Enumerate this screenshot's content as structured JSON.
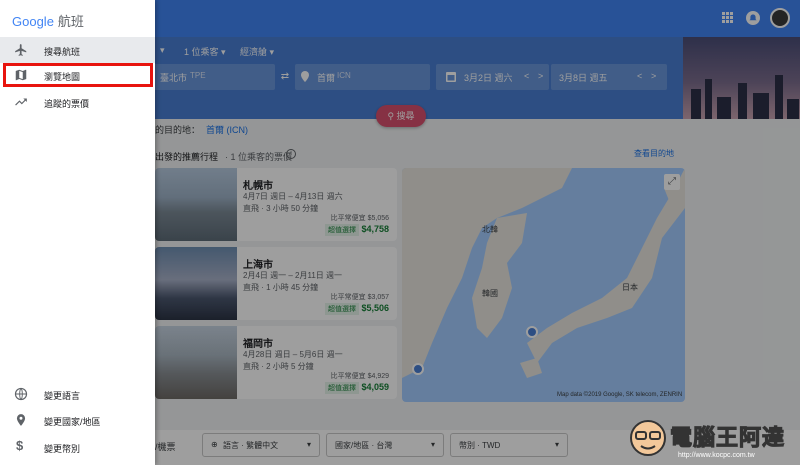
{
  "drawer": {
    "logo_word": "Google",
    "logo_product": "航班",
    "items": [
      {
        "label": "搜尋航班",
        "icon": "airplane-icon"
      },
      {
        "label": "瀏覽地圖",
        "icon": "map-icon"
      },
      {
        "label": "追蹤的票價",
        "icon": "trending-up-icon"
      }
    ],
    "footer": [
      {
        "label": "變更語言",
        "icon": "globe-icon"
      },
      {
        "label": "變更國家/地區",
        "icon": "location-pin-icon"
      },
      {
        "label": "變更幣別",
        "icon": "dollar-icon"
      }
    ]
  },
  "search": {
    "passengers": "1 位乘客 ▾",
    "cabin": "經濟艙 ▾",
    "origin": "臺北市",
    "origin_code": "TPE",
    "destination": "首爾",
    "destination_code": "ICN",
    "depart_date": "3月2日 週六",
    "return_date": "3月8日 週五",
    "button": "搜尋",
    "nav_prev": "<",
    "nav_next": ">"
  },
  "recent": {
    "prefix": "過的目的地：",
    "link": "首爾 (ICN)"
  },
  "recommend": {
    "title": "市出發的推薦行程",
    "subtitle": "· 1 位乘客的票價",
    "map_link": "查看目的地"
  },
  "cards": [
    {
      "city": "札幌市",
      "dates": "4月7日 週日 – 4月13日 週六",
      "flight": "直飛 · 3 小時 50 分鐘",
      "usual": "比平常便宜 $5,056",
      "badge": "超值選擇",
      "price": "$4,758"
    },
    {
      "city": "上海市",
      "dates": "2月4日 週一 – 2月11日 週一",
      "flight": "直飛 · 1 小時 45 分鐘",
      "usual": "比平常便宜 $3,057",
      "badge": "超值選擇",
      "price": "$5,506"
    },
    {
      "city": "福岡市",
      "dates": "4月28日 週日 – 5月6日 週一",
      "flight": "直飛 · 2 小時 5 分鐘",
      "usual": "比平常便宜 $4,929",
      "badge": "超值選擇",
      "price": "$4,059"
    }
  ],
  "map": {
    "label_north": "北韓",
    "label_korea": "韓國",
    "label_japan": "日本",
    "credit": "Map data ©2019 Google, SK telecom, ZENRIN"
  },
  "bottom": {
    "left_text": "班/機票",
    "language": "語言 · 繁體中文",
    "country": "國家/地區 · 台灣",
    "currency": "幣別 · TWD"
  },
  "watermark": {
    "text": "電腦王阿達",
    "url": "http://www.kocpc.com.tw"
  },
  "colors": {
    "brand_blue": "#4285f4",
    "highlight_red": "#e8140e",
    "price_green": "#188038"
  }
}
